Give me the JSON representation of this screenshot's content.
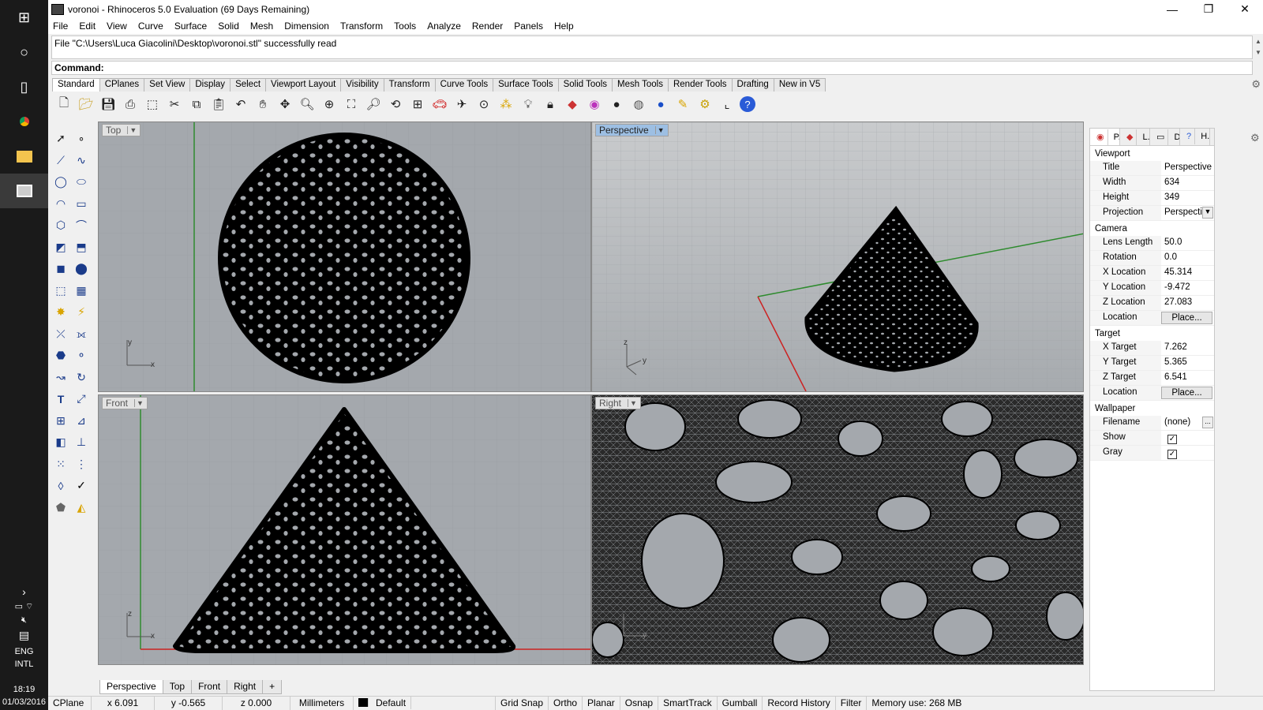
{
  "window": {
    "title": "voronoi - Rhinoceros 5.0 Evaluation (69 Days Remaining)",
    "minimize": "—",
    "maximize": "❐",
    "close": "✕"
  },
  "menu": [
    "File",
    "Edit",
    "View",
    "Curve",
    "Surface",
    "Solid",
    "Mesh",
    "Dimension",
    "Transform",
    "Tools",
    "Analyze",
    "Render",
    "Panels",
    "Help"
  ],
  "history_text": "File \"C:\\Users\\Luca Giacolini\\Desktop\\voronoi.stl\" successfully read",
  "command_label": "Command:",
  "toolbar_tabs": [
    "Standard",
    "CPlanes",
    "Set View",
    "Display",
    "Select",
    "Viewport Layout",
    "Visibility",
    "Transform",
    "Curve Tools",
    "Surface Tools",
    "Solid Tools",
    "Mesh Tools",
    "Render Tools",
    "Drafting",
    "New in V5"
  ],
  "viewports": {
    "top": "Top",
    "perspective": "Perspective",
    "front": "Front",
    "right": "Right",
    "axis_x": "x",
    "axis_y": "y",
    "axis_z": "z"
  },
  "viewport_tabs": [
    "Perspective",
    "Top",
    "Front",
    "Right",
    "+"
  ],
  "panel": {
    "tabs": [
      "P...",
      "L...",
      "Di...",
      "H..."
    ],
    "viewport_section": "Viewport",
    "title_label": "Title",
    "title_value": "Perspective",
    "width_label": "Width",
    "width_value": "634",
    "height_label": "Height",
    "height_value": "349",
    "projection_label": "Projection",
    "projection_value": "Perspective",
    "camera_section": "Camera",
    "lens_label": "Lens Length",
    "lens_value": "50.0",
    "rotation_label": "Rotation",
    "rotation_value": "0.0",
    "xloc_label": "X Location",
    "xloc_value": "45.314",
    "yloc_label": "Y Location",
    "yloc_value": "-9.472",
    "zloc_label": "Z Location",
    "zloc_value": "27.083",
    "loc_label": "Location",
    "place_label": "Place...",
    "target_section": "Target",
    "xt_label": "X Target",
    "xt_value": "7.262",
    "yt_label": "Y Target",
    "yt_value": "5.365",
    "zt_label": "Z Target",
    "zt_value": "6.541",
    "wallpaper_section": "Wallpaper",
    "filename_label": "Filename",
    "filename_value": "(none)",
    "show_label": "Show",
    "gray_label": "Gray",
    "ellipsis": "..."
  },
  "status": {
    "cplane": "CPlane",
    "x": "x 6.091",
    "y": "y -0.565",
    "z": "z 0.000",
    "units": "Millimeters",
    "layer": "Default",
    "grid_snap": "Grid Snap",
    "ortho": "Ortho",
    "planar": "Planar",
    "osnap": "Osnap",
    "smarttrack": "SmartTrack",
    "gumball": "Gumball",
    "record_history": "Record History",
    "filter": "Filter",
    "memory": "Memory use: 268 MB"
  },
  "taskbar": {
    "lang1": "ENG",
    "lang2": "INTL",
    "time": "18:19",
    "date": "01/03/2016"
  }
}
